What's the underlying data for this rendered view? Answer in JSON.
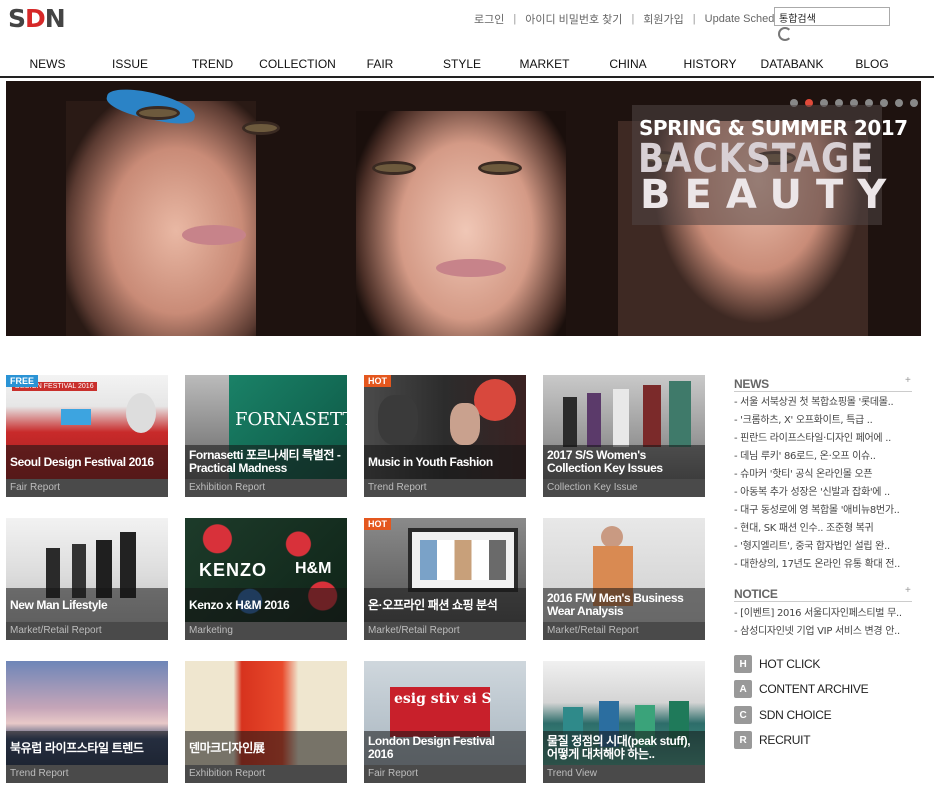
{
  "header": {
    "logo_a": "S",
    "logo_b": "D",
    "logo_c": "N",
    "links": [
      "로그인",
      "아이디 비밀번호 찾기",
      "회원가입",
      "Update Schedule"
    ],
    "search_value": "통합검색"
  },
  "nav": [
    "NEWS",
    "ISSUE",
    "TREND",
    "COLLECTION",
    "FAIR",
    "STYLE",
    "MARKET",
    "CHINA",
    "HISTORY",
    "DATABANK",
    "BLOG"
  ],
  "hero": {
    "line1": "SPRING & SUMMER 2017",
    "line2": "BACKSTAGE",
    "line3": "BEAUTY",
    "slides_total": 9,
    "active_slide": 2
  },
  "cards": [
    {
      "title": "Seoul Design Festival 2016",
      "category": "Fair Report",
      "badge": "FREE"
    },
    {
      "title": "Fornasetti 포르나세티 특별전 - Practical Madness",
      "category": "Exhibition Report",
      "badge": ""
    },
    {
      "title": "Music in Youth Fashion",
      "category": "Trend Report",
      "badge": "HOT"
    },
    {
      "title": "2017 S/S Women's Collection Key Issues",
      "category": "Collection Key Issue",
      "badge": ""
    },
    {
      "title": "New Man Lifestyle",
      "category": "Market/Retail Report",
      "badge": ""
    },
    {
      "title": "Kenzo x H&M 2016",
      "category": "Marketing",
      "badge": ""
    },
    {
      "title": "온·오프라인 패션 쇼핑 분석",
      "category": "Market/Retail Report",
      "badge": "HOT"
    },
    {
      "title": "2016 F/W Men's Business Wear Analysis",
      "category": "Market/Retail Report",
      "badge": ""
    },
    {
      "title": "북유럽 라이프스타일 트렌드",
      "category": "Trend Report",
      "badge": ""
    },
    {
      "title": "덴마크디자인展",
      "category": "Exhibition Report",
      "badge": ""
    },
    {
      "title": "London Design Festival 2016",
      "category": "Fair Report",
      "badge": ""
    },
    {
      "title": "물질 정점의 시대(peak stuff), 어떻게 대처해야 하는..",
      "category": "Trend View",
      "badge": ""
    }
  ],
  "card_art": {
    "fornasetti": "FORNASETTI",
    "kenzo": "KENZO",
    "hm": "H&M",
    "design_festival": "DESIGN FESTIVAL 2016",
    "ldf": "esig stiv si S"
  },
  "sidebar": {
    "news_title": "NEWS",
    "plus": "+",
    "news": [
      "- 서울 서북상권 첫 복합쇼핑몰 '롯데몰..",
      "- '크롬하츠, X' 오프화이트, 특급 ..",
      "- 핀란드 라이프스타일·디자인 페어에 ..",
      "- 데님 루키' 86로드, 온·오프 이슈..",
      "- 슈마커 '핫티' 공식 온라인몰 오픈",
      "- 아동복 추가 성장은 '신발과 잡화'에 ..",
      "- 대구 동성로에 영 복합몰 '애비뉴8번가..",
      "- 현대, SK 패션 인수.. 조준형 복귀",
      "- '형지엘리트', 중국 합자법인 설립 완..",
      "- 대한상의, 17년도 온라인 유통 확대 전.."
    ],
    "notice_title": "NOTICE",
    "notices": [
      "- [이벤트] 2016 서울디자인페스티벌 무..",
      "- 삼성디자인넷 기업 VIP 서비스 변경 안.."
    ],
    "quick": [
      {
        "key": "H",
        "label": "HOT CLICK"
      },
      {
        "key": "A",
        "label": "CONTENT ARCHIVE"
      },
      {
        "key": "C",
        "label": "SDN CHOICE"
      },
      {
        "key": "R",
        "label": "RECRUIT"
      }
    ]
  },
  "colors": {
    "accent": "#d62828",
    "hot": "#e4571e",
    "free": "#2a93d5"
  }
}
